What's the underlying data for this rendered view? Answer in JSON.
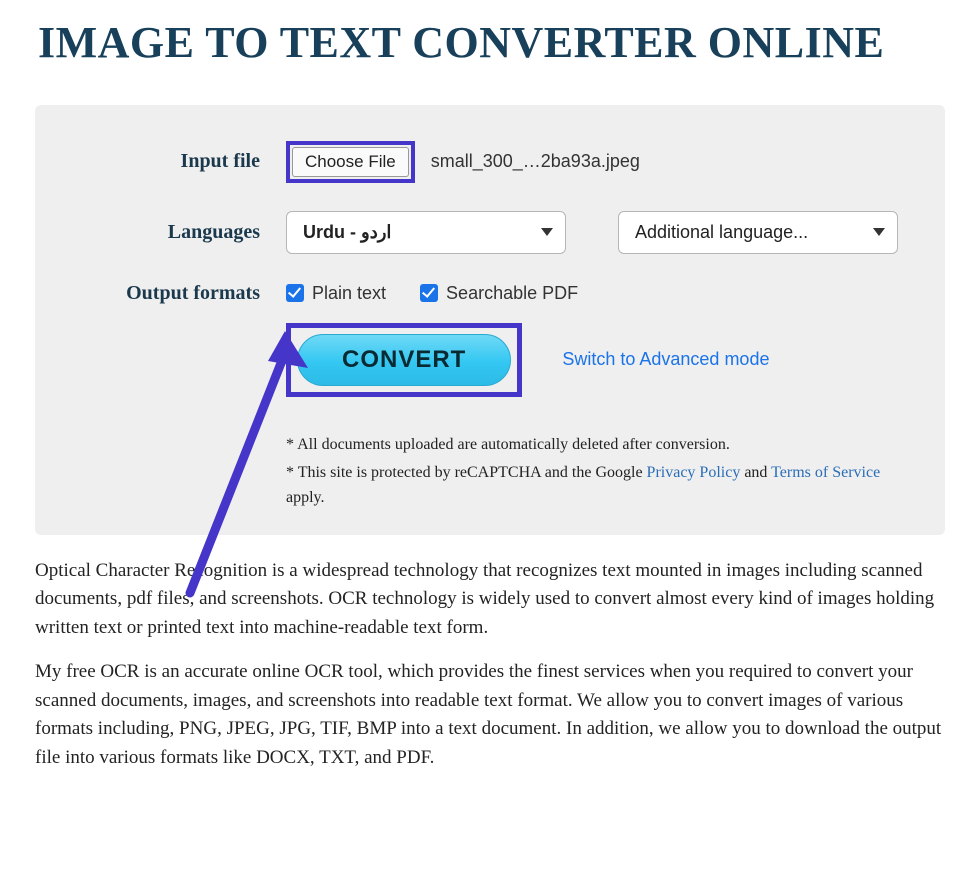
{
  "page": {
    "title": "IMAGE TO TEXT CONVERTER ONLINE"
  },
  "form": {
    "input_file": {
      "label": "Input file",
      "button": "Choose File",
      "filename": "small_300_…2ba93a.jpeg"
    },
    "languages": {
      "label": "Languages",
      "primary_value": "Urdu - اردو",
      "secondary_value": "Additional language..."
    },
    "output": {
      "label": "Output formats",
      "plain_text": "Plain text",
      "searchable_pdf": "Searchable PDF"
    },
    "convert_label": "CONVERT",
    "advanced_link": "Switch to Advanced mode",
    "notes": {
      "n1": "* All documents uploaded are automatically deleted after conversion.",
      "n2a": "* This site is protected by reCAPTCHA and the Google ",
      "privacy": "Privacy Policy",
      "n2b": " and ",
      "terms": "Terms of Service",
      "n2c": " apply."
    }
  },
  "body": {
    "p1": "Optical Character Recognition is a widespread technology that recognizes text mounted in images including scanned documents, pdf files, and screenshots. OCR technology is widely used to convert almost every kind of images holding written text or printed text into machine-readable text form.",
    "p2": "My free OCR is an accurate online OCR tool, which provides the finest services when you required to convert your scanned documents, images, and screenshots into readable text format. We allow you to convert images of various formats including, PNG, JPEG, JPG, TIF, BMP into a text document. In addition, we allow you to download the output file into various formats like DOCX, TXT, and PDF."
  }
}
